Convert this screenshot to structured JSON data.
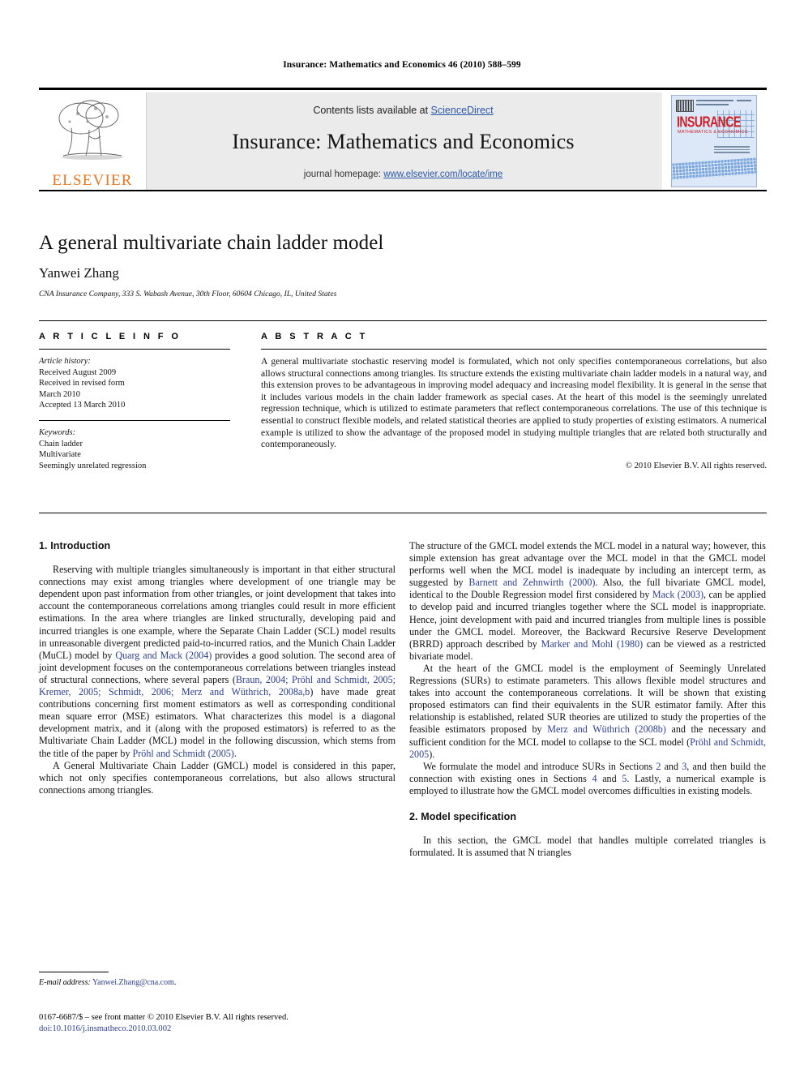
{
  "running_head": "Insurance: Mathematics and Economics 46 (2010) 588–599",
  "masthead": {
    "contents_prefix": "Contents lists available at ",
    "sciencedirect": "ScienceDirect",
    "journal_name": "Insurance: Mathematics and Economics",
    "homepage_prefix": "journal homepage: ",
    "homepage_url": "www.elsevier.com/locate/ime",
    "publisher_logo_text": "ELSEVIER",
    "cover_title": "INSURANCE",
    "cover_subtitle": "MATHEMATICS & ECONOMICS",
    "link_color": "#2c56a8",
    "logo_color": "#E87722"
  },
  "article": {
    "title": "A general multivariate chain ladder model",
    "author": "Yanwei Zhang",
    "affiliation": "CNA Insurance Company, 333 S. Wabash Avenue, 30th Floor, 60604 Chicago, IL, United States"
  },
  "info": {
    "heading": "A R T I C L E    I N F O",
    "history_label": "Article history:",
    "history": [
      "Received August 2009",
      "Received in revised form",
      "March 2010",
      "Accepted 13 March 2010"
    ],
    "keywords_label": "Keywords:",
    "keywords": [
      "Chain ladder",
      "Multivariate",
      "Seemingly unrelated regression"
    ]
  },
  "abstract": {
    "heading": "A B S T R A C T",
    "text": "A general multivariate stochastic reserving model is formulated, which not only specifies contemporaneous correlations, but also allows structural connections among triangles. Its structure extends the existing multivariate chain ladder models in a natural way, and this extension proves to be advantageous in improving model adequacy and increasing model flexibility. It is general in the sense that it includes various models in the chain ladder framework as special cases. At the heart of this model is the seemingly unrelated regression technique, which is utilized to estimate parameters that reflect contemporaneous correlations. The use of this technique is essential to construct flexible models, and related statistical theories are applied to study properties of existing estimators. A numerical example is utilized to show the advantage of the proposed model in studying multiple triangles that are related both structurally and contemporaneously.",
    "copyright": "© 2010 Elsevier B.V. All rights reserved."
  },
  "body": {
    "section1_heading": "1. Introduction",
    "section2_heading": "2. Model specification",
    "left_p1_a": "Reserving with multiple triangles simultaneously is important in that either structural connections may exist among triangles where development of one triangle may be dependent upon past information from other triangles, or joint development that takes into account the contemporaneous correlations among triangles could result in more efficient estimations. In the area where triangles are linked structurally, developing paid and incurred triangles is one example, where the Separate Chain Ladder (SCL) model results in unreasonable divergent predicted paid-to-incurred ratios, and the Munich Chain Ladder (MuCL) model by ",
    "left_cite1": "Quarg and Mack",
    "left_cite1_year": " (2004)",
    "left_p1_b": " provides a good solution. The second area of joint development focuses on the contemporaneous correlations between triangles instead of structural connections, where several papers (",
    "left_cite2": "Braun, 2004; Pröhl and Schmidt, 2005; Kremer, 2005; Schmidt, 2006; Merz and Wüthrich, 2008a,b",
    "left_p1_c": ") have made great contributions concerning first moment estimators as well as corresponding conditional mean square error (MSE) estimators. What characterizes this model is a diagonal development matrix, and it (along with the proposed estimators) is referred to as the Multivariate Chain Ladder (MCL) model in the following discussion, which stems from the title of the paper by ",
    "left_cite3": "Pröhl and Schmidt",
    "left_cite3_year": " (2005)",
    "left_p1_d": ".",
    "left_p2": "A General Multivariate Chain Ladder (GMCL) model is considered in this paper, which not only specifies contemporaneous correlations, but also allows structural connections among triangles.",
    "right_p1_a": "The structure of the GMCL model extends the MCL model in a natural way; however, this simple extension has great advantage over the MCL model in that the GMCL model performs well when the MCL model is inadequate by including an intercept term, as suggested by ",
    "right_cite1": "Barnett and Zehnwirth",
    "right_cite1_year": " (2000)",
    "right_p1_b": ". Also, the full bivariate GMCL model, identical to the Double Regression model first considered by ",
    "right_cite2": "Mack",
    "right_cite2_year": " (2003)",
    "right_p1_c": ", can be applied to develop paid and incurred triangles together where the SCL model is inappropriate. Hence, joint development with paid and incurred triangles from multiple lines is possible under the GMCL model. Moreover, the Backward Recursive Reserve Development (BRRD) approach described by ",
    "right_cite3": "Marker and Mohl",
    "right_cite3_year": " (1980)",
    "right_p1_d": " can be viewed as a restricted bivariate model.",
    "right_p2_a": "At the heart of the GMCL model is the employment of Seemingly Unrelated Regressions (SURs) to estimate parameters. This allows flexible model structures and takes into account the contemporaneous correlations. It will be shown that existing proposed estimators can find their equivalents in the SUR estimator family. After this relationship is established, related SUR theories are utilized to study the properties of the feasible estimators proposed by ",
    "right_cite4": "Merz and Wüthrich",
    "right_cite4_year": " (2008b)",
    "right_p2_b": " and the necessary and sufficient condition for the MCL model to collapse to the SCL model (",
    "right_cite5": "Pröhl and Schmidt, 2005",
    "right_p2_c": ").",
    "right_p3_a": "We formulate the model and introduce SURs in Sections ",
    "right_sec_2": "2",
    "right_p3_b": " and ",
    "right_sec_3": "3",
    "right_p3_c": ", and then build the connection with existing ones in Sections ",
    "right_sec_4": "4",
    "right_p3_d": " and ",
    "right_sec_5": "5",
    "right_p3_e": ". Lastly, a numerical example is employed to illustrate how the GMCL model overcomes difficulties in existing models.",
    "right_p4": "In this section, the GMCL model that handles multiple correlated triangles is formulated. It is assumed that N triangles"
  },
  "footer": {
    "email_label": "E-mail address:",
    "email": "Yanwei.Zhang@cna.com",
    "email_period": ".",
    "issn_line": "0167-6687/$ – see front matter © 2010 Elsevier B.V. All rights reserved.",
    "doi_prefix": "doi:",
    "doi": "10.1016/j.insmatheco.2010.03.002"
  }
}
